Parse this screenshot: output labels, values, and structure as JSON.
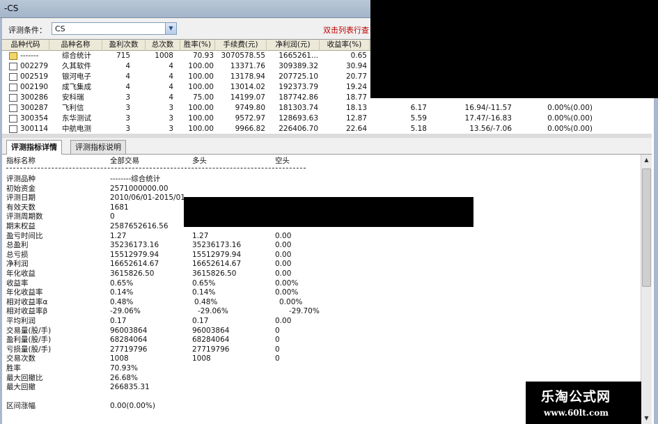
{
  "window": {
    "title": "-CS"
  },
  "condition": {
    "label": "评测条件：",
    "value": "CS",
    "hint": "双击列表行查"
  },
  "grid": {
    "columns": [
      "品种代码",
      "品种名称",
      "盈利次数",
      "总次数",
      "胜率(%)",
      "手续费(元)",
      "净利润(元)",
      "收益率(%)"
    ],
    "rows": [
      {
        "code": "-------",
        "name": "综合统计",
        "wins": "715",
        "total": "1008",
        "winrate": "70.93",
        "fee": "3070578.55",
        "net": "1665261...",
        "ret": "0.65",
        "extra1": "",
        "extra2": "",
        "extra3": "",
        "icon": "summary-icon"
      },
      {
        "code": "002279",
        "name": "久其软件",
        "wins": "4",
        "total": "4",
        "winrate": "100.00",
        "fee": "13371.76",
        "net": "309389.32",
        "ret": "30.94",
        "extra1": "",
        "extra2": "",
        "extra3": "",
        "icon": "document-icon"
      },
      {
        "code": "002519",
        "name": "银河电子",
        "wins": "4",
        "total": "4",
        "winrate": "100.00",
        "fee": "13178.94",
        "net": "207725.10",
        "ret": "20.77",
        "extra1": "",
        "extra2": "",
        "extra3": "",
        "icon": "document-icon"
      },
      {
        "code": "002190",
        "name": "成飞集成",
        "wins": "4",
        "total": "4",
        "winrate": "100.00",
        "fee": "13014.02",
        "net": "192373.79",
        "ret": "19.24",
        "extra1": "",
        "extra2": "",
        "extra3": "",
        "icon": "document-icon"
      },
      {
        "code": "300286",
        "name": "安科瑞",
        "wins": "3",
        "total": "4",
        "winrate": "75.00",
        "fee": "14199.07",
        "net": "187742.86",
        "ret": "18.77",
        "extra1": "",
        "extra2": "",
        "extra3": "",
        "icon": "document-icon"
      },
      {
        "code": "300287",
        "name": "飞利信",
        "wins": "3",
        "total": "3",
        "winrate": "100.00",
        "fee": "9749.80",
        "net": "181303.74",
        "ret": "18.13",
        "extra1": "6.17",
        "extra2": "16.94/-11.57",
        "extra3": "0.00%(0.00)",
        "icon": "document-icon"
      },
      {
        "code": "300354",
        "name": "东华测试",
        "wins": "3",
        "total": "3",
        "winrate": "100.00",
        "fee": "9572.97",
        "net": "128693.63",
        "ret": "12.87",
        "extra1": "5.59",
        "extra2": "17.47/-16.83",
        "extra3": "0.00%(0.00)",
        "icon": "document-icon"
      },
      {
        "code": "300114",
        "name": "中航电测",
        "wins": "3",
        "total": "3",
        "winrate": "100.00",
        "fee": "9966.82",
        "net": "226406.70",
        "ret": "22.64",
        "extra1": "5.18",
        "extra2": "13.56/-7.06",
        "extra3": "0.00%(0.00)",
        "icon": "document-icon"
      }
    ]
  },
  "tabs": [
    {
      "label": "评测指标详情",
      "active": true
    },
    {
      "label": "评测指标说明",
      "active": false
    }
  ],
  "detail": {
    "headers": [
      "指标名称",
      "全部交易",
      "多头",
      "空头"
    ],
    "rows": [
      {
        "name": "评测品种",
        "all": "--------综合统计",
        "long": "",
        "short": ""
      },
      {
        "name": "初始资金",
        "all": "2571000000.00",
        "long": "",
        "short": ""
      },
      {
        "name": "评测日期",
        "all": "2010/06/01-2015/01",
        "long": "",
        "short": ""
      },
      {
        "name": "有效天数",
        "all": "1681",
        "long": "",
        "short": ""
      },
      {
        "name": "评测周期数",
        "all": "0",
        "long": "",
        "short": ""
      },
      {
        "name": "期末权益",
        "all": "2587652616.56",
        "long": "",
        "short": ""
      },
      {
        "name": "盈亏时间比",
        "all": "1.27",
        "long": "1.27",
        "short": "0.00"
      },
      {
        "name": "总盈利",
        "all": "35236173.16",
        "long": "35236173.16",
        "short": "0.00"
      },
      {
        "name": "总亏损",
        "all": "15512979.94",
        "long": "15512979.94",
        "short": "0.00"
      },
      {
        "name": "净利润",
        "all": "16652614.67",
        "long": "16652614.67",
        "short": "0.00"
      },
      {
        "name": "年化收益",
        "all": "3615826.50",
        "long": "3615826.50",
        "short": "0.00"
      },
      {
        "name": "收益率",
        "all": "0.65%",
        "long": "0.65%",
        "short": "0.00%"
      },
      {
        "name": "年化收益率",
        "all": "0.14%",
        "long": "0.14%",
        "short": "0.00%"
      },
      {
        "name": "相对收益率α",
        "all": "0.48%",
        "long": "0.48%",
        "short": "0.00%"
      },
      {
        "name": "相对收益率β",
        "all": "-29.06%",
        "long": "-29.06%",
        "short": "-29.70%"
      },
      {
        "name": "平均利润",
        "all": "0.17",
        "long": "0.17",
        "short": "0.00"
      },
      {
        "name": "交易量(股/手)",
        "all": "96003864",
        "long": "96003864",
        "short": "0"
      },
      {
        "name": "盈利量(股/手)",
        "all": "68284064",
        "long": "68284064",
        "short": "0"
      },
      {
        "name": "亏损量(股/手)",
        "all": "27719796",
        "long": "27719796",
        "short": "0"
      },
      {
        "name": "交易次数",
        "all": "1008",
        "long": "1008",
        "short": "0"
      },
      {
        "name": "胜率",
        "all": "70.93%",
        "long": "",
        "short": ""
      },
      {
        "name": "最大回撤比",
        "all": "26.68%",
        "long": "",
        "short": ""
      },
      {
        "name": "最大回撤",
        "all": "266835.31",
        "long": "",
        "short": ""
      },
      {
        "name": "",
        "all": "",
        "long": "",
        "short": ""
      },
      {
        "name": "区间涨幅",
        "all": "0.00(0.00%)",
        "long": "",
        "short": ""
      }
    ]
  },
  "watermark": {
    "name": "乐淘公式网",
    "url": "www.60lt.com"
  }
}
